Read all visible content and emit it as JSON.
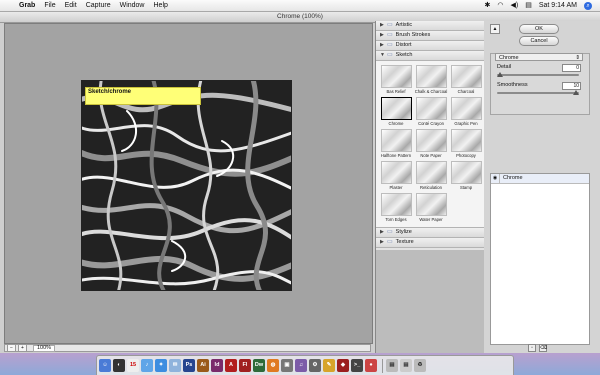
{
  "menubar": {
    "app": "Grab",
    "menus": [
      "File",
      "Edit",
      "Capture",
      "Window",
      "Help"
    ],
    "clock": "Sat 9:14 AM"
  },
  "window": {
    "title": "Chrome (100%)"
  },
  "preview": {
    "note_text": "Sketch/chrome",
    "zoom": "100%"
  },
  "gallery": {
    "categories_top": [
      "Artistic",
      "Brush Strokes",
      "Distort",
      "Sketch"
    ],
    "filters": [
      {
        "label": "Bas Relief"
      },
      {
        "label": "Chalk & Charcoal"
      },
      {
        "label": "Charcoal"
      },
      {
        "label": "Chrome",
        "selected": true
      },
      {
        "label": "Conté Crayon"
      },
      {
        "label": "Graphic Pen"
      },
      {
        "label": "Halftone Pattern"
      },
      {
        "label": "Note Paper"
      },
      {
        "label": "Photocopy"
      },
      {
        "label": "Plaster"
      },
      {
        "label": "Reticulation"
      },
      {
        "label": "Stamp"
      },
      {
        "label": "Torn Edges"
      },
      {
        "label": "Water Paper"
      }
    ],
    "categories_bottom": [
      "Stylize",
      "Texture"
    ]
  },
  "panel": {
    "ok": "OK",
    "cancel": "Cancel",
    "filter_select": "Chrome",
    "detail_label": "Detail",
    "detail_value": "0",
    "detail_level": 0.0,
    "smooth_label": "Smoothness",
    "smooth_value": "10",
    "smooth_level": 1.0,
    "layer_name": "Chrome"
  },
  "colors": {
    "note_bg": "#ffff77",
    "preview_bg": "#a3a3a3",
    "select_border": "#000000"
  },
  "dock_icons": [
    "finder-icon",
    "dashboard-icon",
    "ical-icon",
    "itunes-icon",
    "safari-icon",
    "mail-icon",
    "photoshop-icon",
    "illustrator-icon",
    "indesign-icon",
    "acrobat-icon",
    "flash-icon",
    "dreamweaver-icon",
    "firefox-icon",
    "system-prefs-icon",
    "trash-icon"
  ]
}
